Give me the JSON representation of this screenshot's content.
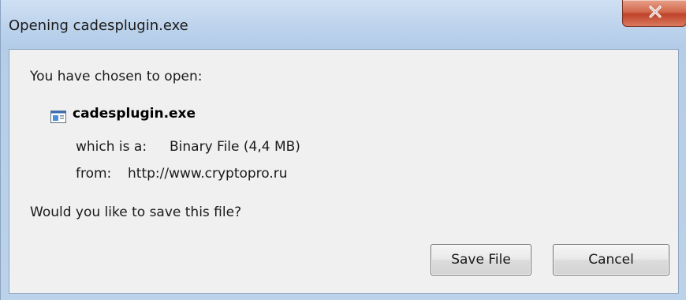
{
  "window": {
    "title": "Opening cadesplugin.exe"
  },
  "dialog": {
    "intro": "You have chosen to open:",
    "file_name": "cadesplugin.exe",
    "type_label": "which is a:",
    "type_value": "Binary File (4,4 MB)",
    "from_label": "from:",
    "from_value": "http://www.cryptopro.ru",
    "question": "Would you like to save this file?"
  },
  "buttons": {
    "save_label": "Save File",
    "cancel_label": "Cancel"
  },
  "icons": {
    "close": "close-icon",
    "file": "exe-file-icon"
  },
  "colors": {
    "titlebar": "#c3d7ee",
    "close_button": "#c8543a",
    "content_background": "#f0f0f0"
  }
}
